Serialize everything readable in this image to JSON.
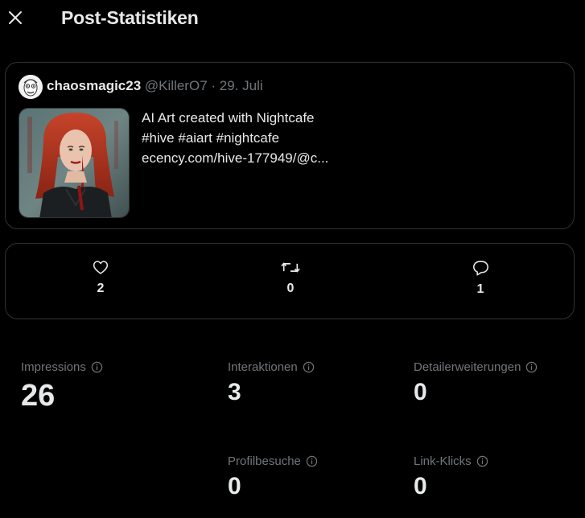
{
  "header": {
    "title": "Post-Statistiken",
    "close_icon": "close-icon"
  },
  "post": {
    "author_name": "chaosmagic23",
    "author_handle": "@KillerO7",
    "separator": "·",
    "date": "29. Juli",
    "text_lines": [
      "AI Art created with Nightcafe",
      "#hive #aiart #nightcafe",
      "ecency.com/hive-177949/@c..."
    ]
  },
  "engagement": {
    "likes": {
      "icon": "heart-icon",
      "count": "2"
    },
    "reposts": {
      "icon": "repost-icon",
      "count": "0"
    },
    "replies": {
      "icon": "reply-icon",
      "count": "1"
    }
  },
  "stats": {
    "impressions": {
      "label": "Impressions",
      "value": "26"
    },
    "interactions": {
      "label": "Interaktionen",
      "value": "3"
    },
    "detail_expansions": {
      "label": "Detailerweiterungen",
      "value": "0"
    },
    "profile_visits": {
      "label": "Profilbesuche",
      "value": "0"
    },
    "link_clicks": {
      "label": "Link-Klicks",
      "value": "0"
    }
  },
  "colors": {
    "background": "#000000",
    "text_primary": "#e7e9ea",
    "text_secondary": "#71767b",
    "border": "#2f3336"
  }
}
